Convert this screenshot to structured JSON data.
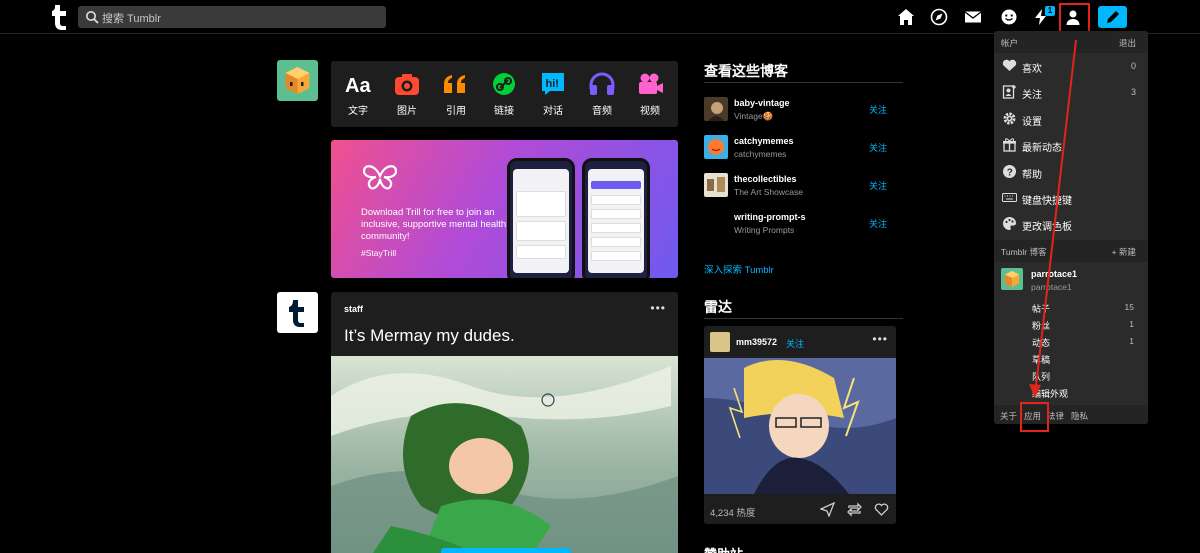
{
  "header": {
    "search_placeholder": "搜索 Tumblr",
    "activity_badge": "1"
  },
  "post_types": [
    {
      "label": "文字",
      "icon": "text-aa-icon",
      "color": "#ffffff"
    },
    {
      "label": "图片",
      "icon": "camera-icon",
      "color": "#ff4930"
    },
    {
      "label": "引用",
      "icon": "quote-icon",
      "color": "#ff8a00"
    },
    {
      "label": "链接",
      "icon": "link-icon",
      "color": "#00cf35"
    },
    {
      "label": "对话",
      "icon": "chat-icon",
      "color": "#00b8ff"
    },
    {
      "label": "音频",
      "icon": "headphones-icon",
      "color": "#7c5cff"
    },
    {
      "label": "视频",
      "icon": "video-camera-icon",
      "color": "#ff62ce"
    }
  ],
  "ad": {
    "text": "Download Trill for free to join an inclusive, supportive mental health community!",
    "tag": "#StayTrill"
  },
  "post": {
    "author": "staff",
    "title": "It’s Mermay my dudes."
  },
  "sidebar": {
    "check_out_title": "查看这些博客",
    "blogs": [
      {
        "name": "baby-vintage",
        "subtitle": "Vintage🍪",
        "follow": "关注"
      },
      {
        "name": "catchymemes",
        "subtitle": "catchymemes",
        "follow": "关注"
      },
      {
        "name": "thecollectibles",
        "subtitle": "The Art Showcase",
        "follow": "关注"
      },
      {
        "name": "writing-prompt-s",
        "subtitle": "Writing Prompts",
        "follow": "关注"
      }
    ],
    "explore_link": "深入探索 Tumblr",
    "radar_title": "雷达",
    "radar": {
      "name": "mm39572",
      "follow": "关注",
      "notes": "4,234 热度"
    },
    "next_heading_partial": "赞助站"
  },
  "account_menu": {
    "header_left": "帐户",
    "header_right": "退出",
    "items": [
      {
        "label": "喜欢",
        "count": "0",
        "icon": "heart-icon"
      },
      {
        "label": "关注",
        "count": "3",
        "icon": "following-icon"
      },
      {
        "label": "设置",
        "count": "",
        "icon": "gear-icon"
      },
      {
        "label": "最新动态",
        "count": "",
        "icon": "gift-icon"
      },
      {
        "label": "帮助",
        "count": "",
        "icon": "help-icon"
      },
      {
        "label": "键盘快捷键",
        "count": "",
        "icon": "keyboard-icon"
      },
      {
        "label": "更改调色板",
        "count": "",
        "icon": "palette-icon"
      }
    ],
    "blogs_header": "Tumblr 博客",
    "new_blog": "+ 新建",
    "blog": {
      "name": "parrotace1",
      "title": "parrotace1"
    },
    "blog_stats": [
      {
        "label": "帖子",
        "count": "15"
      },
      {
        "label": "粉丝",
        "count": "1"
      },
      {
        "label": "动态",
        "count": "1"
      },
      {
        "label": "草稿",
        "count": ""
      },
      {
        "label": "队列",
        "count": ""
      },
      {
        "label": "编辑外观",
        "count": ""
      }
    ],
    "footer": [
      "关于",
      "应用",
      "法律",
      "隐私"
    ]
  },
  "colors": {
    "accent": "#00b8ff",
    "annotation_red": "#e1251b",
    "panel": "#1e1e1e",
    "menu": "#2b2b2b"
  }
}
